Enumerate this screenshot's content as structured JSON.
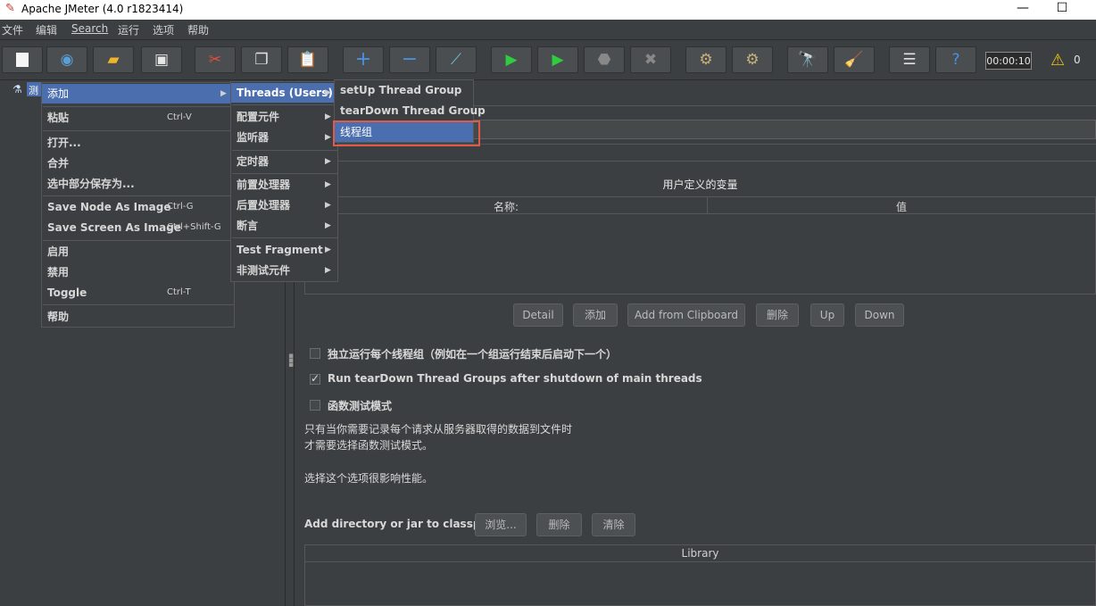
{
  "window": {
    "title": "Apache JMeter (4.0 r1823414)",
    "minimize": "—",
    "maximize": "☐"
  },
  "menubar": [
    {
      "label": "文件"
    },
    {
      "label": "编辑"
    },
    {
      "label": "Search"
    },
    {
      "label": "运行"
    },
    {
      "label": "选项"
    },
    {
      "label": "帮助"
    }
  ],
  "toolbar": {
    "timer": "00:00:10",
    "warning_count": "0",
    "icons": [
      "new-icon",
      "templates-icon",
      "open-icon",
      "save-icon",
      "cut-icon",
      "copy-icon",
      "paste-icon",
      "expand-icon",
      "collapse-icon",
      "toggle-icon",
      "start-icon",
      "start-no-pause-icon",
      "stop-icon",
      "shutdown-icon",
      "clear-icon",
      "clear-all-icon",
      "search-icon",
      "reset-search-icon",
      "function-helper-icon",
      "help-icon"
    ]
  },
  "tree": {
    "node_label": "测"
  },
  "context_menu": {
    "items": [
      {
        "label": "添加",
        "shortcut": "",
        "has_sub": true
      },
      {
        "label": "粘贴",
        "shortcut": "Ctrl-V"
      },
      {
        "label": "打开...",
        "shortcut": ""
      },
      {
        "label": "合并",
        "shortcut": ""
      },
      {
        "label": "选中部分保存为...",
        "shortcut": ""
      },
      {
        "label": "Save Node As Image",
        "shortcut": "Ctrl-G"
      },
      {
        "label": "Save Screen As Image",
        "shortcut": "Ctrl+Shift-G"
      },
      {
        "label": "启用",
        "shortcut": ""
      },
      {
        "label": "禁用",
        "shortcut": ""
      },
      {
        "label": "Toggle",
        "shortcut": "Ctrl-T"
      },
      {
        "label": "帮助",
        "shortcut": ""
      }
    ]
  },
  "add_submenu": {
    "items": [
      {
        "label": "Threads (Users)"
      },
      {
        "label": "配置元件"
      },
      {
        "label": "监听器"
      },
      {
        "label": "定时器"
      },
      {
        "label": "前置处理器"
      },
      {
        "label": "后置处理器"
      },
      {
        "label": "断言"
      },
      {
        "label": "Test Fragment"
      },
      {
        "label": "非测试元件"
      }
    ]
  },
  "threads_submenu": {
    "items": [
      {
        "label": "setUp Thread Group"
      },
      {
        "label": "tearDown Thread Group"
      },
      {
        "label": "线程组"
      }
    ]
  },
  "testplan": {
    "udv_title": "用户定义的变量",
    "col_name": "名称:",
    "col_value": "值",
    "buttons": {
      "detail": "Detail",
      "add": "添加",
      "add_clipboard": "Add from Clipboard",
      "delete": "删除",
      "up": "Up",
      "down": "Down"
    },
    "cb_serialize": "独立运行每个线程组（例如在一个组运行结束后启动下一个）",
    "cb_teardown": "Run tearDown Thread Groups after shutdown of main threads",
    "cb_functional": "函数测试模式",
    "note_line1": "只有当你需要记录每个请求从服务器取得的数据到文件时",
    "note_line2": "才需要选择函数测试模式。",
    "note_line3": "选择这个选项很影响性能。",
    "classpath_label": "Add directory or jar to classpath",
    "browse": "浏览...",
    "cp_delete": "删除",
    "cp_clear": "清除",
    "library_header": "Library"
  }
}
